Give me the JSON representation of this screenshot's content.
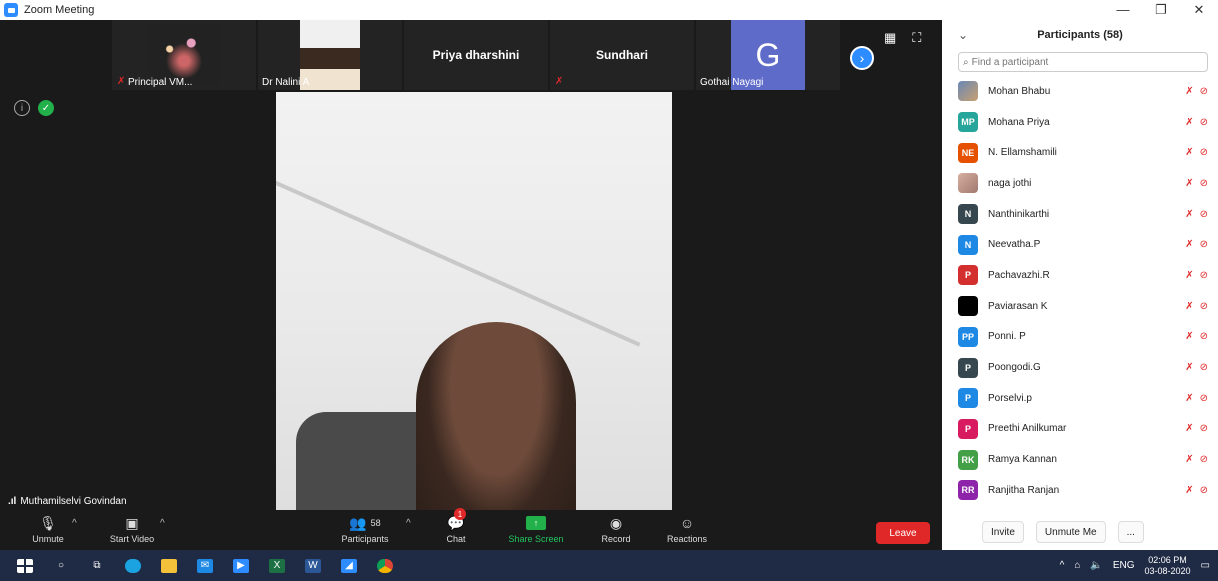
{
  "window": {
    "title": "Zoom Meeting",
    "controls": [
      "—",
      "❐",
      "✕"
    ]
  },
  "strip": {
    "tiles": [
      {
        "name": "Principal VM...",
        "kind": "fireworks",
        "muted": true
      },
      {
        "name": "Dr Nalini A",
        "kind": "photo",
        "muted": false
      },
      {
        "name": "Priya dharshini",
        "kind": "text",
        "muted": false
      },
      {
        "name": "Sundhari",
        "kind": "text",
        "muted": true
      },
      {
        "name": "Gothai Nayagi",
        "kind": "letter",
        "letter": "G",
        "muted": false
      }
    ]
  },
  "speaker": {
    "name": "Muthamilselvi Govindan"
  },
  "toolbar": {
    "unmute": "Unmute",
    "start_video": "Start Video",
    "participants": "Participants",
    "participants_count": "58",
    "chat": "Chat",
    "chat_badge": "1",
    "share_screen": "Share Screen",
    "record": "Record",
    "reactions": "Reactions",
    "leave": "Leave"
  },
  "panel": {
    "title": "Participants (58)",
    "search_placeholder": "Find a participant",
    "participants": [
      {
        "initials": "",
        "name": "Mohan Bhabu",
        "color": "photo1"
      },
      {
        "initials": "MP",
        "name": "Mohana Priya",
        "color": "#26a69a"
      },
      {
        "initials": "NE",
        "name": "N. Ellamshamili",
        "color": "#e65100"
      },
      {
        "initials": "",
        "name": "naga jothi",
        "color": "photo2"
      },
      {
        "initials": "N",
        "name": "Nanthinikarthi",
        "color": "#37474f"
      },
      {
        "initials": "N",
        "name": "Neevatha.P",
        "color": "#1e88e5"
      },
      {
        "initials": "P",
        "name": "Pachavazhi.R",
        "color": "#d32f2f"
      },
      {
        "initials": "",
        "name": "Paviarasan K",
        "color": "#000000"
      },
      {
        "initials": "PP",
        "name": "Ponni. P",
        "color": "#1e88e5"
      },
      {
        "initials": "P",
        "name": "Poongodi.G",
        "color": "#37474f"
      },
      {
        "initials": "P",
        "name": "Porselvi.p",
        "color": "#1e88e5"
      },
      {
        "initials": "P",
        "name": "Preethi Anilkumar",
        "color": "#d81b60"
      },
      {
        "initials": "RK",
        "name": "Ramya Kannan",
        "color": "#43a047"
      },
      {
        "initials": "RR",
        "name": "Ranjitha Ranjan",
        "color": "#8e24aa"
      }
    ],
    "invite": "Invite",
    "unmute_me": "Unmute Me",
    "more": "..."
  },
  "taskbar": {
    "lang": "ENG",
    "time": "02:06 PM",
    "date": "03-08-2020"
  },
  "colors": {
    "accent": "#2d8cff",
    "danger": "#e02828",
    "share": "#22b04b"
  }
}
